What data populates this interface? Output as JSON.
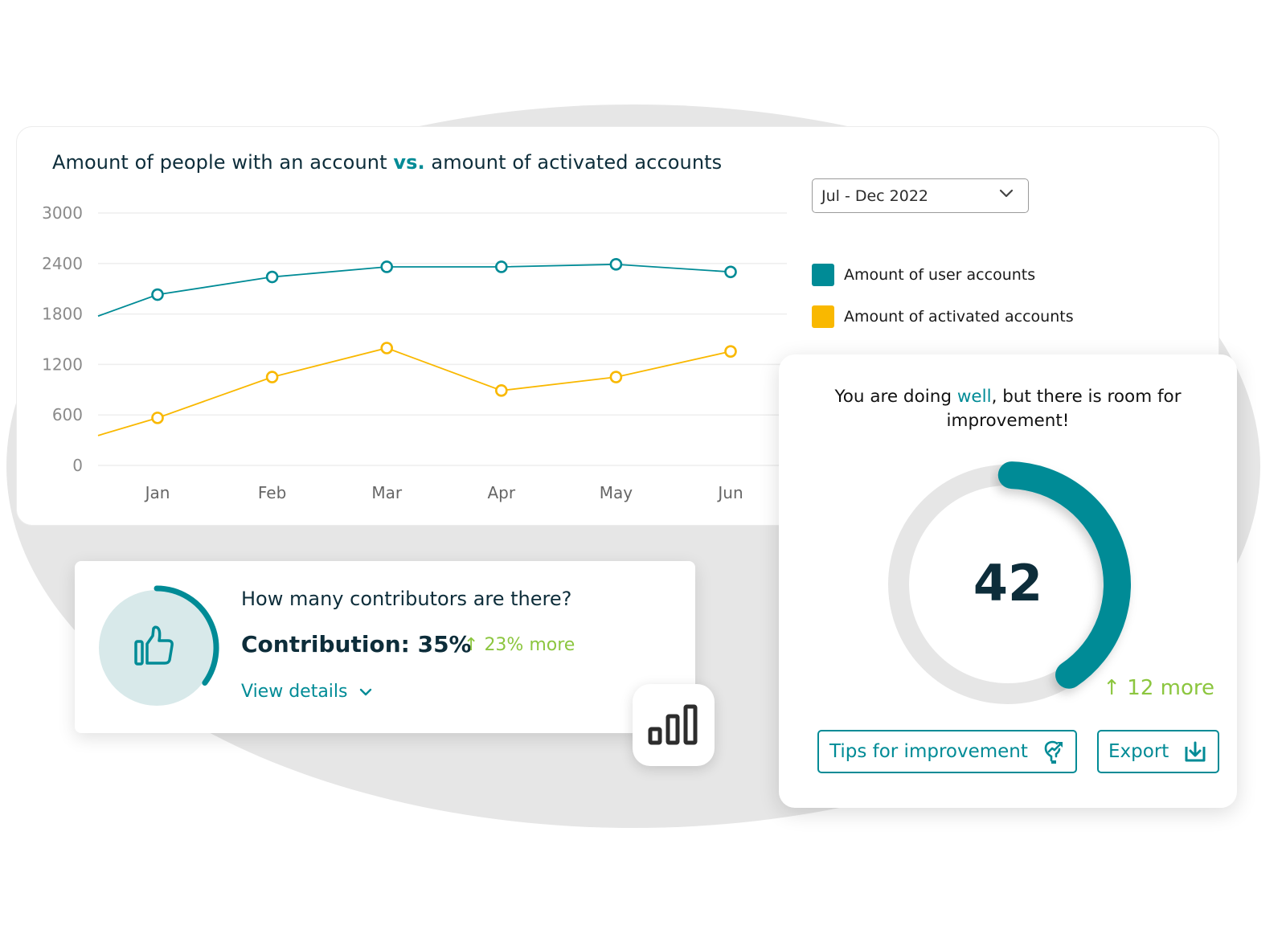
{
  "chart_card": {
    "title_part1": "Amount of people with an account",
    "title_accent": "vs.",
    "title_part2": "amount of activated accounts",
    "period_select": {
      "selected": "Jul - Dec 2022",
      "icon": "chevron-down-icon"
    },
    "legend": [
      {
        "label": "Amount of user accounts",
        "color": "#008b96"
      },
      {
        "label": "Amount of activated accounts",
        "color": "#f9b800"
      }
    ]
  },
  "chart_data": {
    "type": "line",
    "title": "Amount of people with an account vs. amount of activated accounts",
    "categories": [
      "Jan",
      "Feb",
      "Mar",
      "Apr",
      "May",
      "Jun"
    ],
    "yticks": [
      0,
      600,
      1200,
      1800,
      2400,
      3000
    ],
    "ylim": [
      0,
      3000
    ],
    "grid": true,
    "legend_position": "right",
    "series": [
      {
        "name": "Amount of user accounts",
        "color": "#008b96",
        "lead_in": 1775,
        "values": [
          2030,
          2240,
          2360,
          2360,
          2390,
          2300
        ]
      },
      {
        "name": "Amount of activated accounts",
        "color": "#f9b800",
        "lead_in": 355,
        "values": [
          565,
          1050,
          1395,
          890,
          1050,
          1355
        ]
      }
    ],
    "xlabel": "",
    "ylabel": ""
  },
  "contributors": {
    "question": "How many contributors are there?",
    "value_label": "Contribution: 35%",
    "progress_fraction": 0.35,
    "delta": "23% more",
    "delta_icon": "arrow-up-icon",
    "view_details": "View details",
    "icon": "thumbs-up-icon",
    "accent": "#008b96",
    "positive_color": "#8cc63f"
  },
  "score": {
    "message_part1": "You are doing",
    "message_accent": "well",
    "message_part2": ", but there is room for improvement!",
    "value": "42",
    "progress_fraction": 0.4,
    "delta": "12 more",
    "tips_button": "Tips for improvement",
    "export_button": "Export"
  }
}
